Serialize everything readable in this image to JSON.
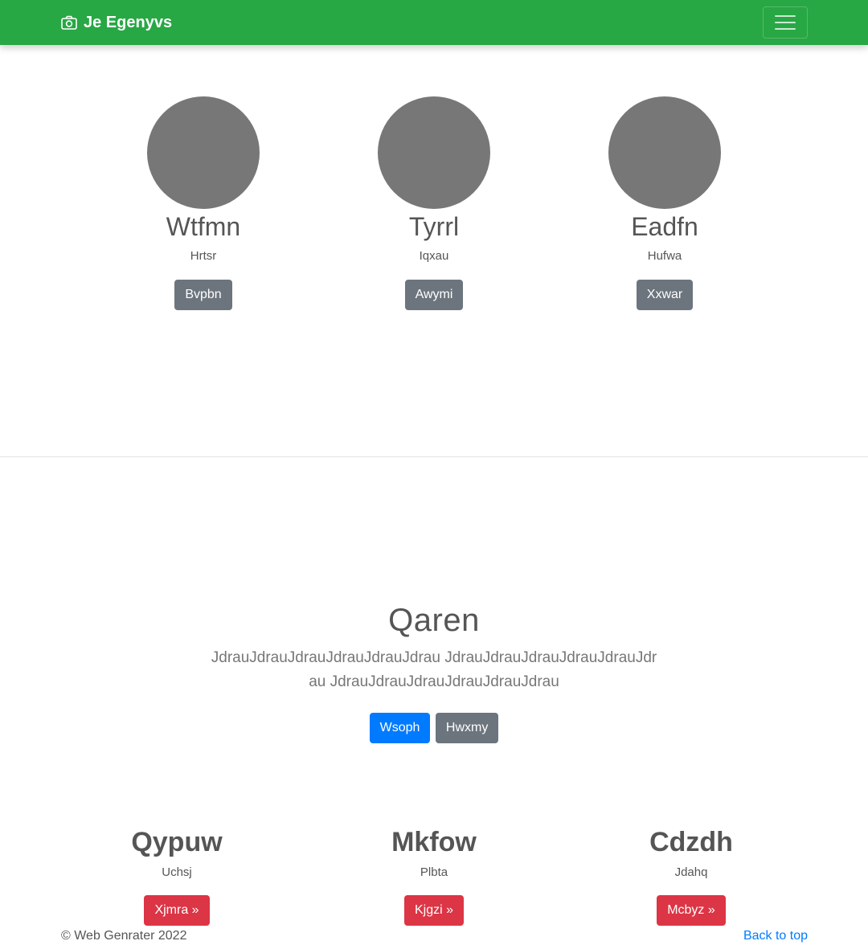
{
  "navbar": {
    "brand": "Je Egenyvs",
    "brand_icon": "camera-icon",
    "toggler_icon": "hamburger-icon",
    "background": "#28a745"
  },
  "profiles": [
    {
      "name": "Wtfmn",
      "subtitle": "Hrtsr",
      "button": "Bvpbn"
    },
    {
      "name": "Tyrrl",
      "subtitle": "Iqxau",
      "button": "Awymi"
    },
    {
      "name": "Eadfn",
      "subtitle": "Hufwa",
      "button": "Xxwar"
    }
  ],
  "hero": {
    "title": "Qaren",
    "lead": "JdrauJdrauJdrauJdrauJdrauJdrau JdrauJdrauJdrauJdrauJdrauJdrau JdrauJdrauJdrauJdrauJdrauJdrau",
    "primary_button": "Wsoph",
    "secondary_button": "Hwxmy"
  },
  "features": [
    {
      "title": "Qypuw",
      "subtitle": "Uchsj",
      "button": "Xjmra »"
    },
    {
      "title": "Mkfow",
      "subtitle": "Plbta",
      "button": "Kjgzi »"
    },
    {
      "title": "Cdzdh",
      "subtitle": "Jdahq",
      "button": "Mcbyz »"
    }
  ],
  "footer": {
    "copyright": "© Web Genrater 2022",
    "back_to_top": "Back to top"
  },
  "colors": {
    "primary": "#007bff",
    "secondary": "#6c757d",
    "danger": "#dc3545",
    "avatar": "#777777"
  }
}
